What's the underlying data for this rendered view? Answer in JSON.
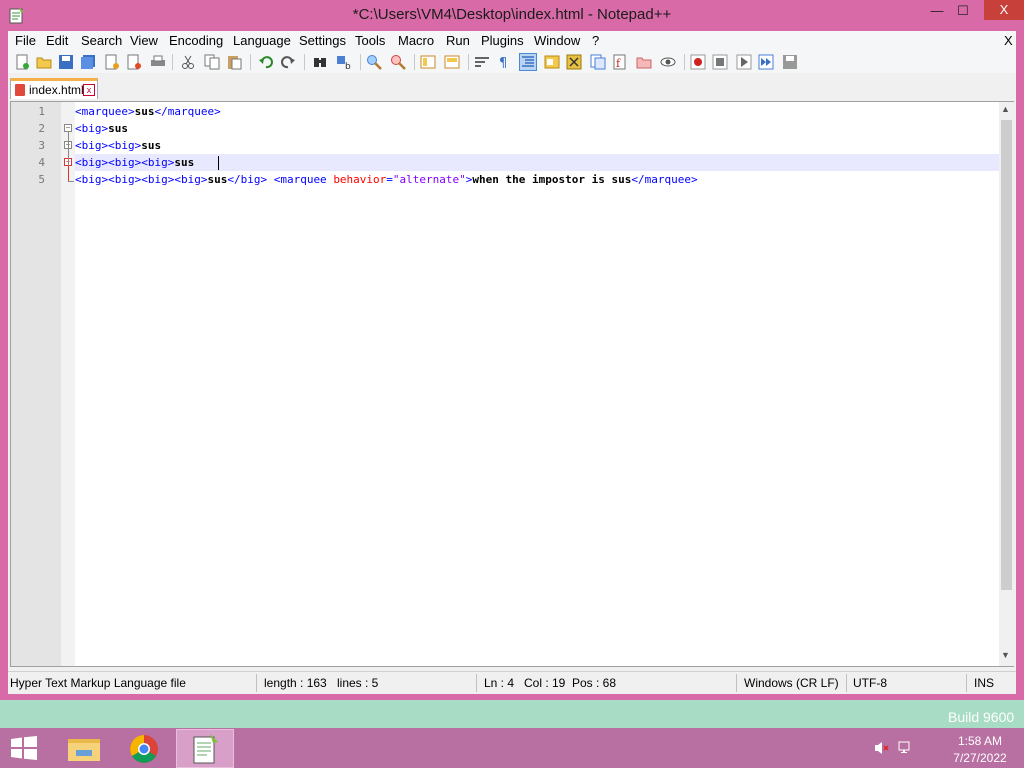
{
  "window": {
    "title": "*C:\\Users\\VM4\\Desktop\\index.html - Notepad++",
    "minimize": "—",
    "maximize": "☐",
    "close": "X"
  },
  "menu": {
    "items": [
      "File",
      "Edit",
      "Search",
      "View",
      "Encoding",
      "Language",
      "Settings",
      "Tools",
      "Macro",
      "Run",
      "Plugins",
      "Window",
      "?"
    ],
    "close_doc": "X"
  },
  "tab": {
    "label": "index.html",
    "close": "x"
  },
  "editor": {
    "line_numbers": [
      "1",
      "2",
      "3",
      "4",
      "5"
    ],
    "lines": [
      [
        {
          "t": "<marquee>",
          "c": "tag"
        },
        {
          "t": "sus",
          "c": "txt"
        },
        {
          "t": "</marquee>",
          "c": "tag"
        }
      ],
      [
        {
          "t": "<big>",
          "c": "tag"
        },
        {
          "t": "sus",
          "c": "txt"
        }
      ],
      [
        {
          "t": "<big><big>",
          "c": "tag"
        },
        {
          "t": "sus",
          "c": "txt"
        }
      ],
      [
        {
          "t": "<big><big><big>",
          "c": "tag"
        },
        {
          "t": "sus",
          "c": "txt"
        }
      ],
      [
        {
          "t": "<big><big><big><big>",
          "c": "tag"
        },
        {
          "t": "sus",
          "c": "txt"
        },
        {
          "t": "</big>",
          "c": "tag"
        },
        {
          "t": " ",
          "c": "txt"
        },
        {
          "t": "<marquee ",
          "c": "tag"
        },
        {
          "t": "behavior",
          "c": "attr"
        },
        {
          "t": "=",
          "c": "tag"
        },
        {
          "t": "\"alternate\"",
          "c": "str"
        },
        {
          "t": ">",
          "c": "tag"
        },
        {
          "t": "when the impostor is sus",
          "c": "txt"
        },
        {
          "t": "</marquee>",
          "c": "tag"
        }
      ]
    ]
  },
  "status": {
    "file_type": "Hyper Text Markup Language file",
    "length": "length : 163",
    "lines": "lines : 5",
    "ln": "Ln : 4",
    "col": "Col : 19",
    "pos": "Pos : 68",
    "eol": "Windows (CR LF)",
    "encoding": "UTF-8",
    "mode": "INS"
  },
  "desktop": {
    "build": "Build 9600"
  },
  "taskbar": {
    "time": "1:58 AM",
    "date": "7/27/2022"
  },
  "colors": {
    "frame": "#d96aa8",
    "taskbar": "#b870a2",
    "tag": "#0000ff",
    "attr": "#ff0000",
    "string": "#8000ff"
  }
}
